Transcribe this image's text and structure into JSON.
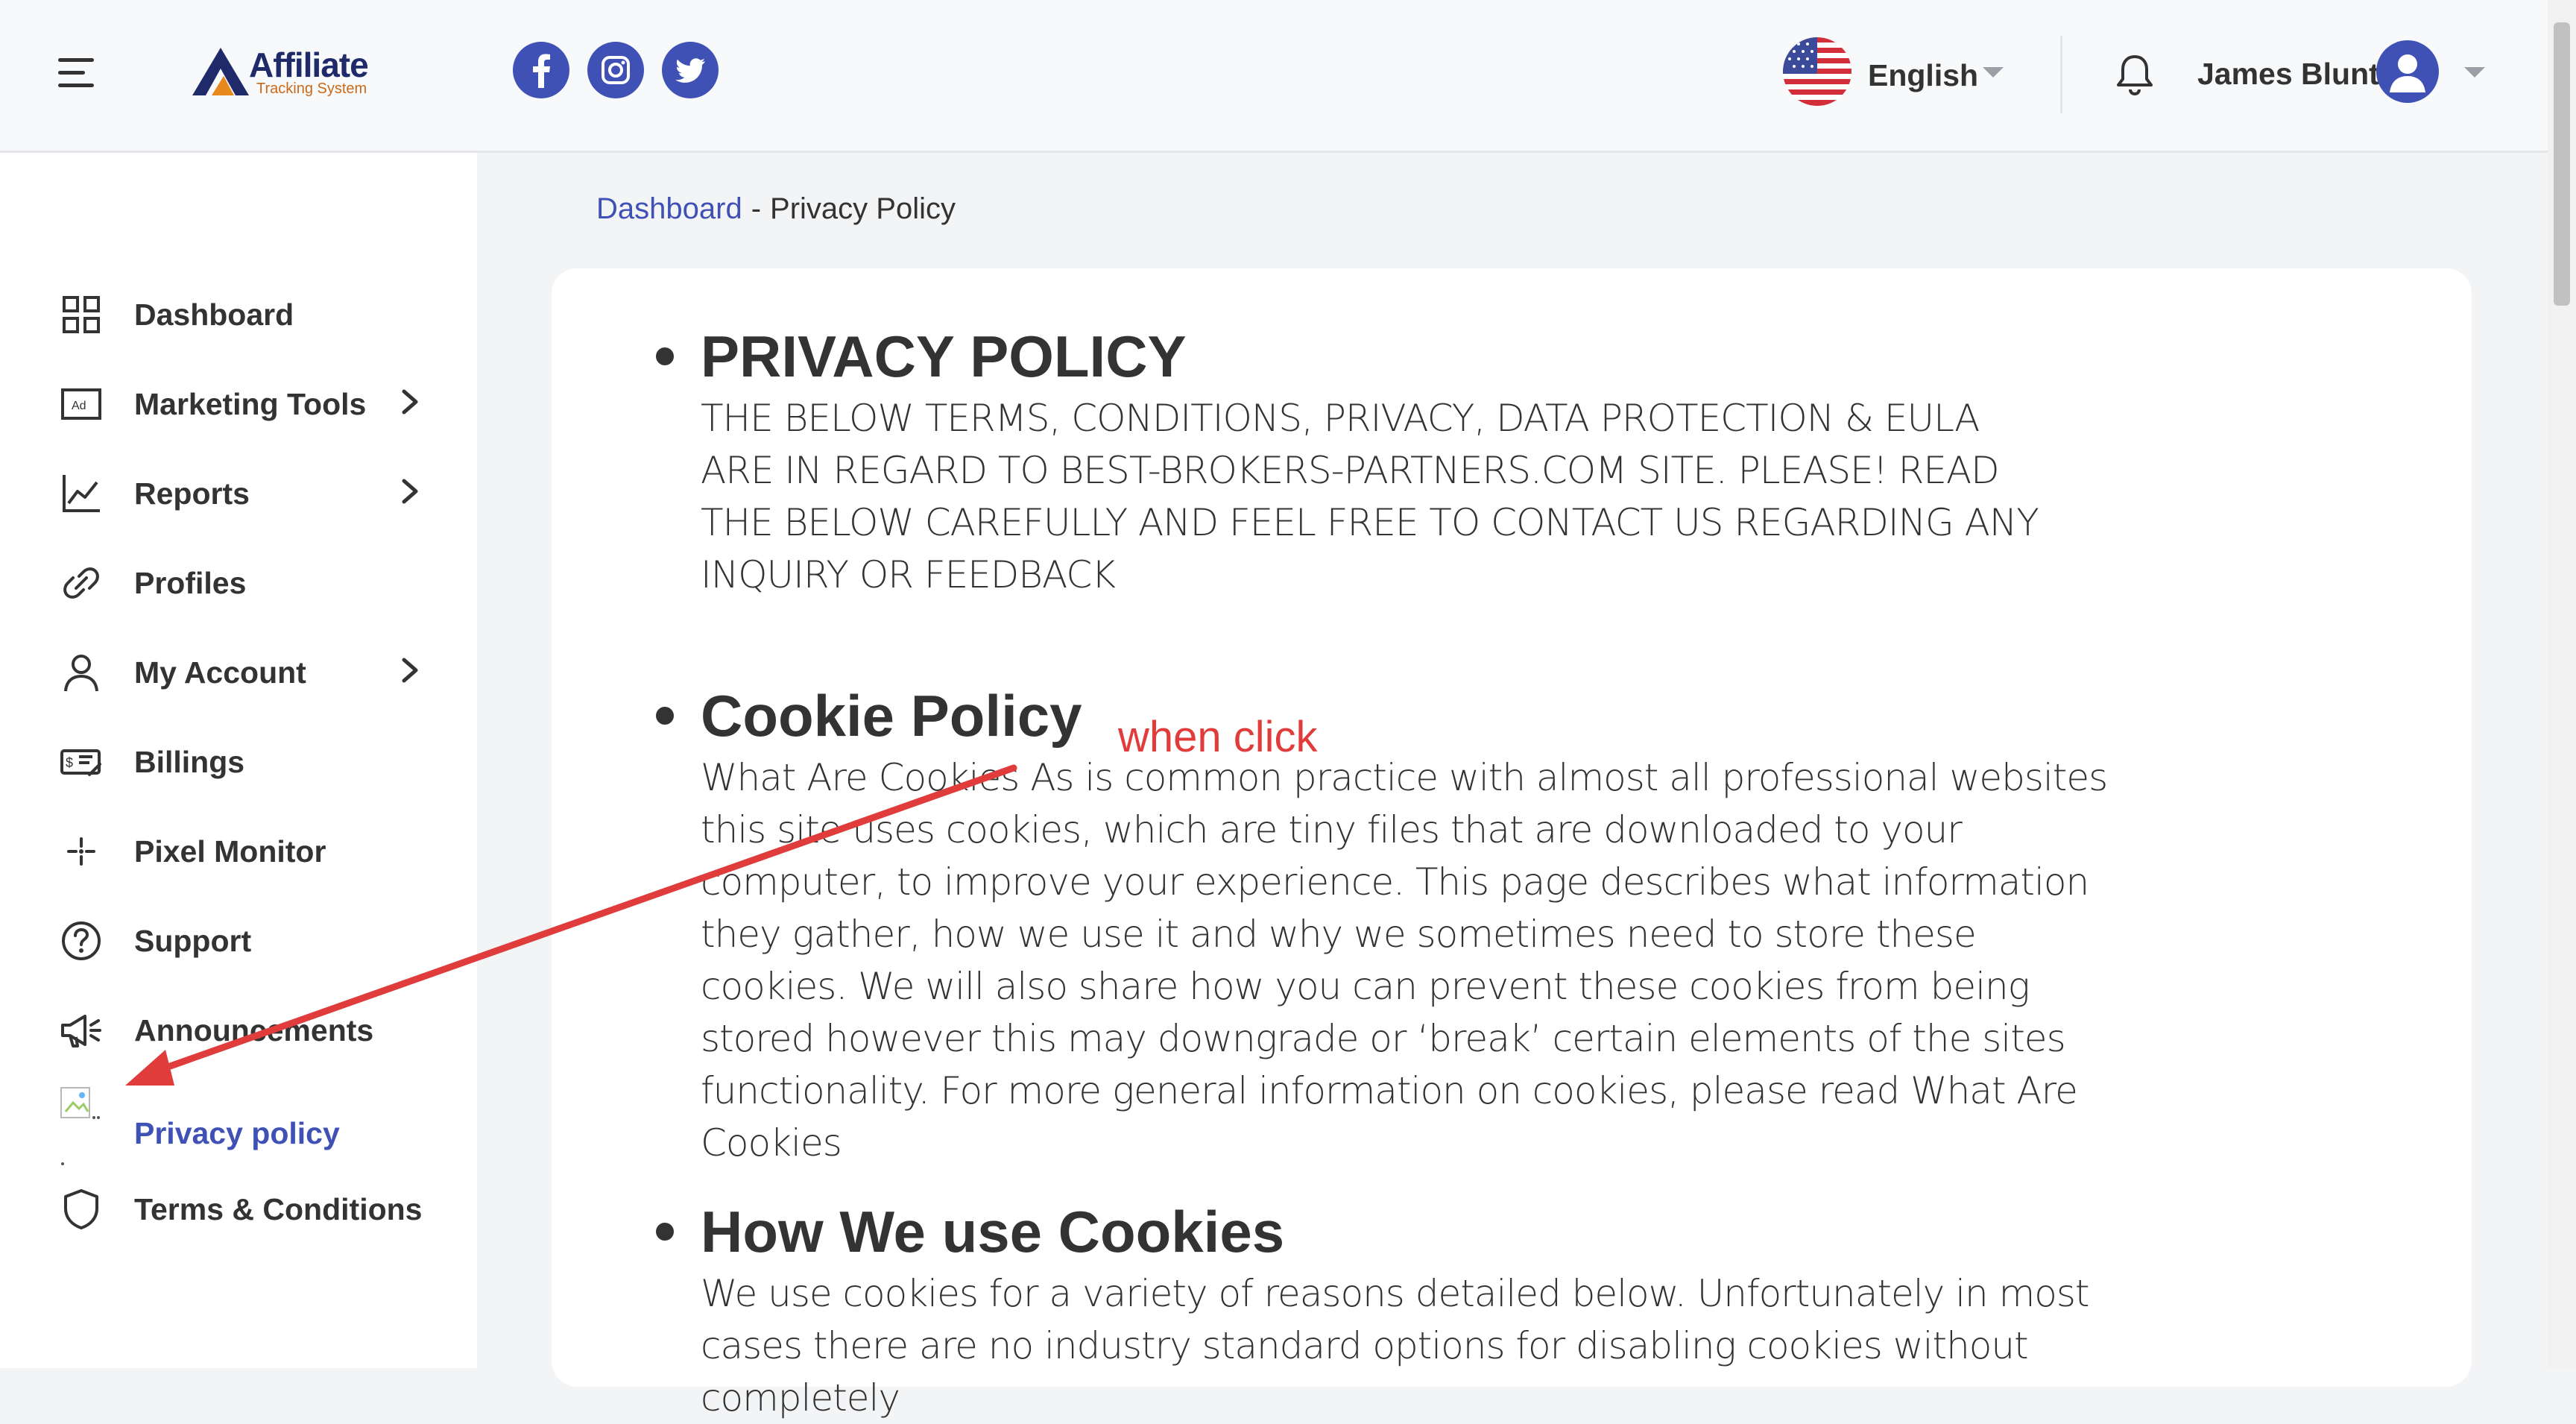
{
  "header": {
    "logo": {
      "word": "Affiliate",
      "sub": "Tracking System"
    },
    "social": [
      "facebook-icon",
      "instagram-icon",
      "twitter-icon"
    ],
    "language": "English",
    "user_name": "James Blunt"
  },
  "sidebar": {
    "items": [
      {
        "label": "Dashboard",
        "icon": "grid-icon",
        "has_children": false
      },
      {
        "label": "Marketing Tools",
        "icon": "ad-icon",
        "has_children": true
      },
      {
        "label": "Reports",
        "icon": "chart-line-icon",
        "has_children": true
      },
      {
        "label": "Profiles",
        "icon": "link-icon",
        "has_children": false
      },
      {
        "label": "My Account",
        "icon": "user-icon",
        "has_children": true
      },
      {
        "label": "Billings",
        "icon": "billing-icon",
        "has_children": false
      },
      {
        "label": "Pixel Monitor",
        "icon": "pixel-icon",
        "has_children": false
      },
      {
        "label": "Support",
        "icon": "help-circle-icon",
        "has_children": false
      },
      {
        "label": "Announcements",
        "icon": "megaphone-icon",
        "has_children": false
      },
      {
        "label": "Privacy policy",
        "icon": "broken-image-icon",
        "has_children": false,
        "active": true
      },
      {
        "label": "Terms & Conditions",
        "icon": "shield-icon",
        "has_children": false
      }
    ]
  },
  "breadcrumb": {
    "link": "Dashboard",
    "separator": "-",
    "current": "Privacy Policy"
  },
  "content": {
    "sections": [
      {
        "title": "PRIVACY POLICY",
        "body": "THE BELOW TERMS, CONDITIONS, PRIVACY, DATA PROTECTION & EULA ARE IN REGARD TO BEST-BROKERS-PARTNERS.COM SITE. PLEASE! READ THE BELOW CAREFULLY AND FEEL FREE TO CONTACT US REGARDING ANY INQUIRY OR FEEDBACK"
      },
      {
        "title": "Cookie Policy",
        "body": "What Are Cookies As is common practice with almost all professional websites this site uses cookies, which are tiny files that are downloaded to your computer, to improve your experience. This page describes what information they gather, how we use it and why we sometimes need to store these cookies. We will also share how you can prevent these cookies from being stored however this may downgrade or ‘break’ certain elements of the sites functionality. For more general information on cookies, please read What Are Cookies"
      },
      {
        "title": "How We use Cookies",
        "body": "We use cookies for a variety of reasons detailed below. Unfortunately in most cases there are no industry standard options for disabling cookies without completely"
      }
    ]
  },
  "annotation": {
    "text": "when click",
    "color": "#e03c3c"
  },
  "colors": {
    "accent": "#3f51b5",
    "text": "#333333",
    "background": "#f3f4f6"
  }
}
